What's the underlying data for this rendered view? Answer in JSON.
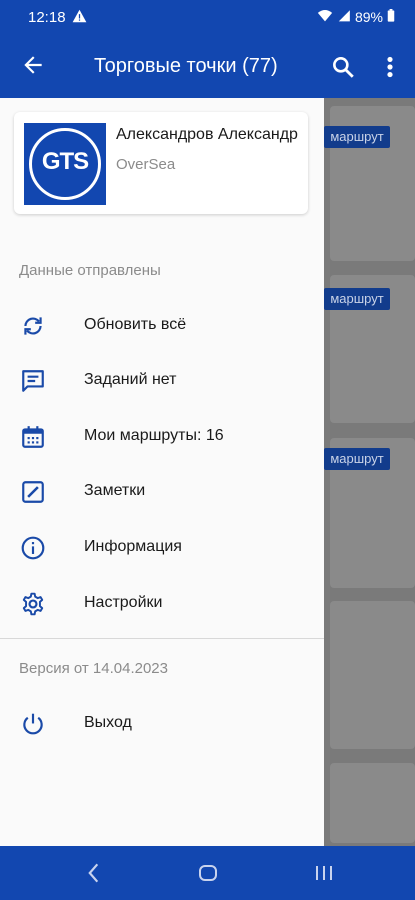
{
  "status_bar": {
    "time": "12:18",
    "battery": "89%",
    "warning_icon": "warning-icon",
    "wifi_icon": "wifi-icon",
    "signal_icon": "signal-icon",
    "battery_icon": "battery-icon"
  },
  "app_bar": {
    "title": "Торговые точки (77)",
    "back_icon": "arrow-back-icon",
    "search_icon": "search-icon",
    "more_icon": "more-vert-icon"
  },
  "background_list": {
    "badge_label": "маршрут"
  },
  "drawer": {
    "profile": {
      "logo_text": "GTS",
      "name": "Александров Александр",
      "company": "OverSea"
    },
    "sync_status": "Данные отправлены",
    "items": [
      {
        "label": "Обновить всё",
        "icon": "sync-icon"
      },
      {
        "label": "Заданий нет",
        "icon": "message-icon"
      },
      {
        "label": "Мои маршруты: 16",
        "icon": "calendar-icon"
      },
      {
        "label": "Заметки",
        "icon": "edit-note-icon"
      },
      {
        "label": "Информация",
        "icon": "info-icon"
      },
      {
        "label": "Настройки",
        "icon": "settings-icon"
      }
    ],
    "version": "Версия от 14.04.2023",
    "logout": {
      "label": "Выход",
      "icon": "power-icon"
    }
  },
  "colors": {
    "primary": "#1247b0",
    "icon_blue": "#1a4aa8",
    "drawer_bg": "#fafafa",
    "secondary_text": "#8b8b8b"
  }
}
